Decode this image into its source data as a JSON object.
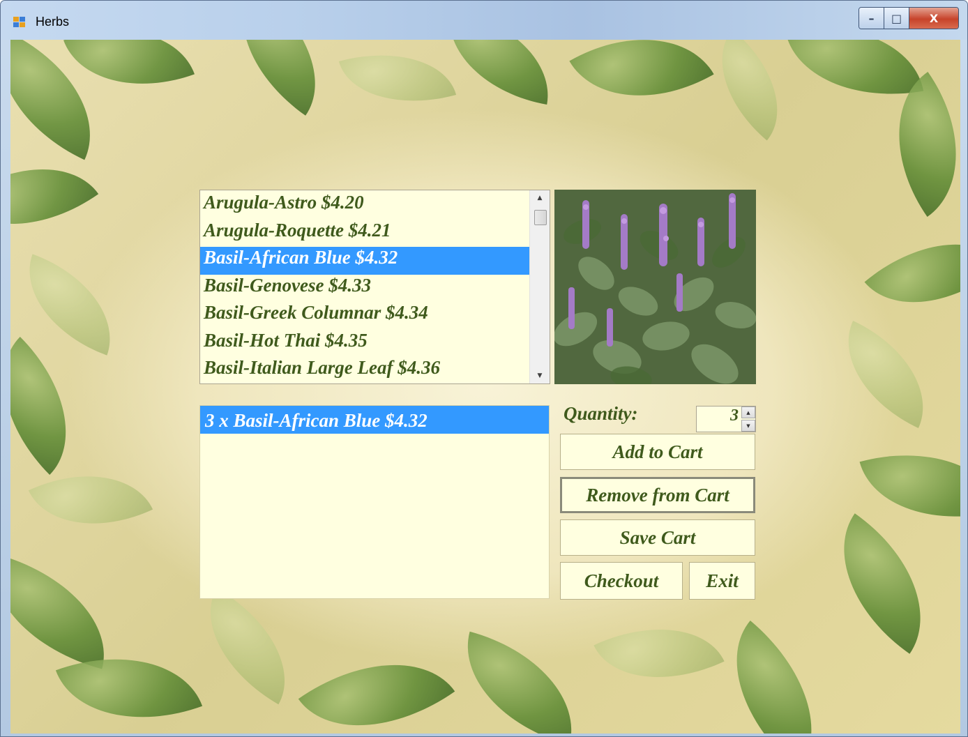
{
  "window": {
    "title": "Herbs",
    "controls": {
      "minimize": "–",
      "maximize": "□",
      "close": "X"
    }
  },
  "herb_list": {
    "items": [
      "Arugula-Astro $4.20",
      "Arugula-Roquette $4.21",
      "Basil-African Blue $4.32",
      "Basil-Genovese $4.33",
      "Basil-Greek Columnar $4.34",
      "Basil-Hot Thai $4.35",
      "Basil-Italian Large Leaf $4.36"
    ],
    "selected": "Basil-African Blue $4.32"
  },
  "herb_image": {
    "subject": "Basil-African Blue plant photo",
    "icon": "purple-basil-photo"
  },
  "cart": {
    "items": [
      "3 x Basil-African Blue $4.32"
    ]
  },
  "quantity": {
    "label": "Quantity:",
    "value": "3"
  },
  "buttons": {
    "add": "Add to Cart",
    "remove": "Remove from Cart",
    "save": "Save Cart",
    "checkout": "Checkout",
    "exit": "Exit"
  },
  "colors": {
    "list_background": "#ffffe0",
    "selection": "#3399ff",
    "text": "#3f5a1c"
  }
}
